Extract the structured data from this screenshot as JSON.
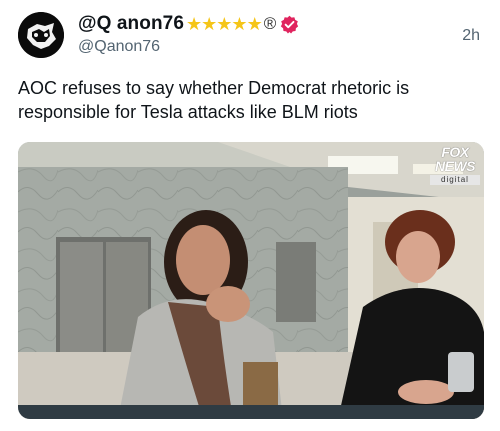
{
  "post": {
    "display_name": "@Q anon76",
    "badge_stars": "★★★★★",
    "badge_registered": "®",
    "handle": "@Qanon76",
    "timestamp": "2h",
    "text": "AOC refuses to say whether Democrat rhetoric is responsible for Tesla attacks like BLM riots",
    "media": {
      "watermark": {
        "line1": "FOX",
        "line2": "NEWS",
        "line3": "digital"
      },
      "video_progress": 0.0
    }
  },
  "colors": {
    "verified_badge": "#e0245e",
    "stars": "#f5c518",
    "muted_text": "#536471",
    "progress_track": "#2f3b43"
  },
  "icons": {
    "avatar": "anonymous-mask-avatar",
    "verified": "verified-badge-icon"
  }
}
